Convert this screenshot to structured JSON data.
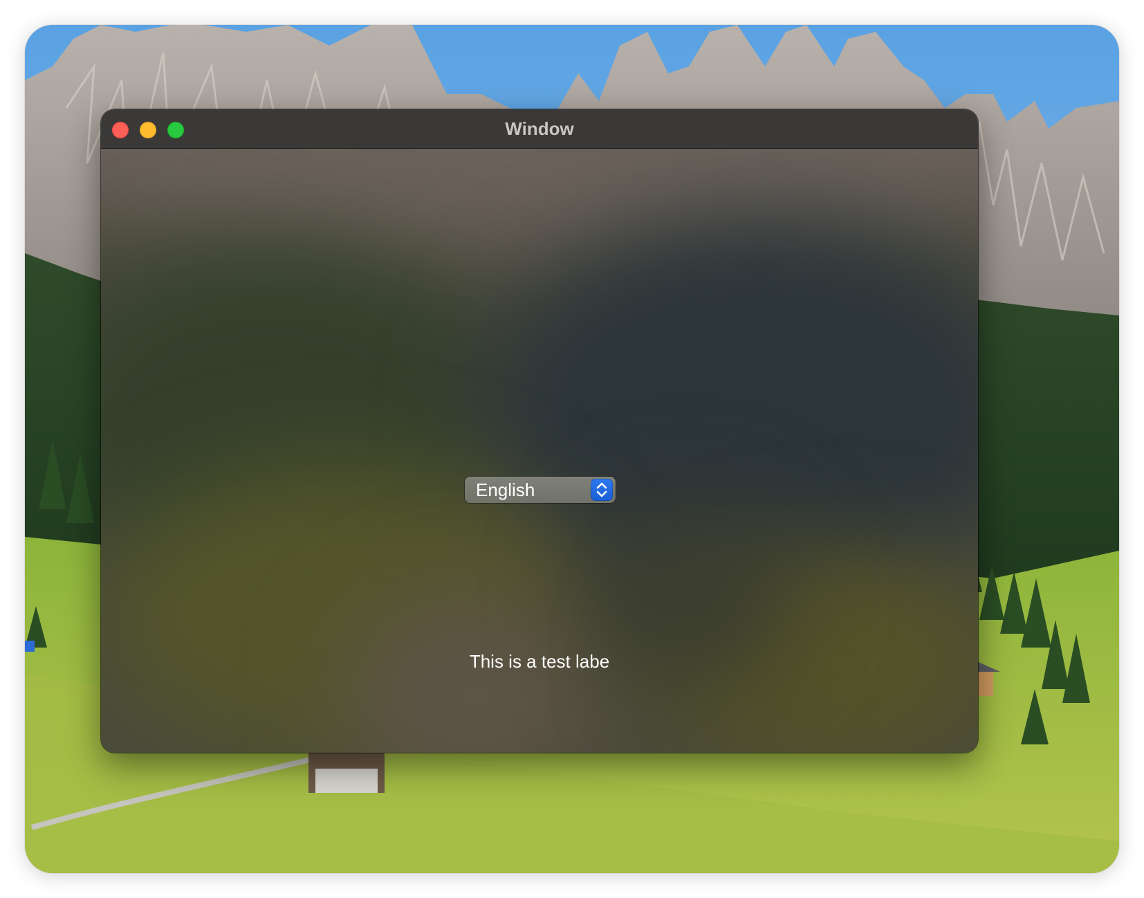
{
  "window": {
    "title": "Window"
  },
  "language_popup": {
    "selected": "English"
  },
  "test_label": {
    "text": "This is a test labe"
  },
  "icons": {
    "close": "close-button-icon",
    "minimize": "minimize-button-icon",
    "zoom": "zoom-button-icon",
    "popup_arrows": "chevron-up-down-icon"
  },
  "colors": {
    "close": "#fe5f57",
    "minimize": "#febc2e",
    "zoom": "#28c840",
    "accent": "#2d79ef",
    "titlebar": "#3a3937"
  }
}
